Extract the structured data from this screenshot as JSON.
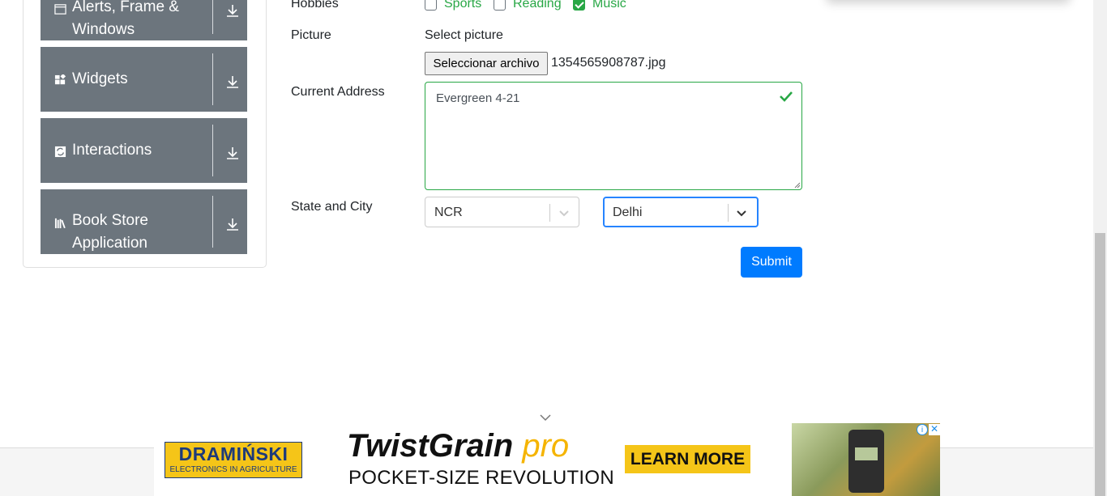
{
  "sidebar": {
    "groups": [
      {
        "label_line1": "Alerts, Frame &",
        "label_line2": "Windows",
        "icon": "window-icon"
      },
      {
        "label": "Widgets",
        "icon": "widgets-icon"
      },
      {
        "label": "Interactions",
        "icon": "interactions-icon"
      },
      {
        "label_line1": "Book Store",
        "label_line2": "Application",
        "icon": "books-icon"
      }
    ]
  },
  "form": {
    "hobbies_label": "Hobbies",
    "hobbies": [
      {
        "label": "Sports",
        "checked": false
      },
      {
        "label": "Reading",
        "checked": false
      },
      {
        "label": "Music",
        "checked": true
      }
    ],
    "picture_label": "Picture",
    "select_picture": "Select picture",
    "file_button": "Seleccionar archivo",
    "file_name": "1354565908787.jpg",
    "address_label": "Current Address",
    "address_value": "Evergreen 4-21",
    "state_city_label": "State and City",
    "state_value": "NCR",
    "city_value": "Delhi",
    "submit_label": "Submit"
  },
  "ad": {
    "brand_line1": "DRAMIŃSKI",
    "brand_line2": "ELECTRONICS IN AGRICULTURE",
    "product": "TwistGrain",
    "product_suffix": "pro",
    "tagline": "POCKET-SIZE REVOLUTION",
    "cta": "LEARN MORE",
    "info": "i",
    "close": "✕"
  },
  "colors": {
    "sidebar_bg": "#6c757d",
    "success": "#28a745",
    "primary": "#007bff",
    "ad_yellow": "#f5c518"
  }
}
